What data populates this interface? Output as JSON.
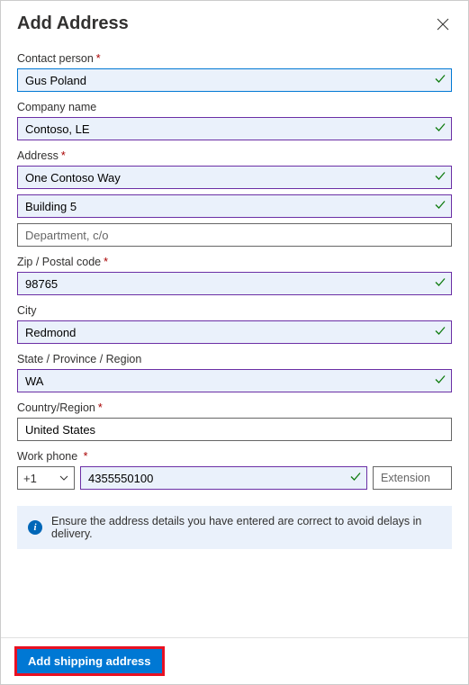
{
  "header": {
    "title": "Add Address"
  },
  "fields": {
    "contact": {
      "label": "Contact person",
      "value": "Gus Poland",
      "required": true
    },
    "company": {
      "label": "Company name",
      "value": "Contoso, LE",
      "required": false
    },
    "address": {
      "label": "Address",
      "line1": "One Contoso Way",
      "line2": "Building 5",
      "line3": "",
      "line3_placeholder": "Department, c/o",
      "required": true
    },
    "zip": {
      "label": "Zip / Postal code",
      "value": "98765",
      "required": true
    },
    "city": {
      "label": "City",
      "value": "Redmond",
      "required": false
    },
    "state": {
      "label": "State / Province / Region",
      "value": "WA",
      "required": false
    },
    "country": {
      "label": "Country/Region",
      "value": "United States",
      "required": true
    },
    "phone": {
      "label": "Work phone",
      "code": "+1",
      "number": "4355550100",
      "ext_placeholder": "Extension",
      "required": true
    }
  },
  "info": {
    "text": "Ensure the address details you have entered are correct to avoid delays in delivery."
  },
  "footer": {
    "submit": "Add shipping address"
  }
}
